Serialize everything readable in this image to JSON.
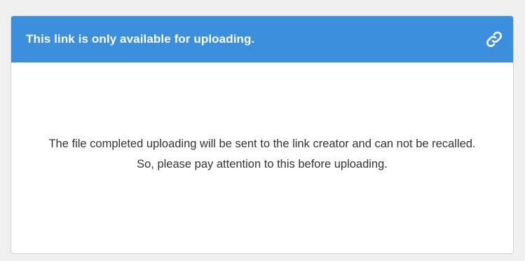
{
  "card": {
    "title": "This link is only available for uploading.",
    "header_icon": "link-icon",
    "notice_text": "The file completed uploading will be sent to the link creator and can not be recalled. So, please pay attention to this before uploading."
  },
  "colors": {
    "header_bg": "#3b8fdc",
    "page_bg": "#f0f0f0",
    "card_bg": "#ffffff",
    "text": "#333333"
  }
}
